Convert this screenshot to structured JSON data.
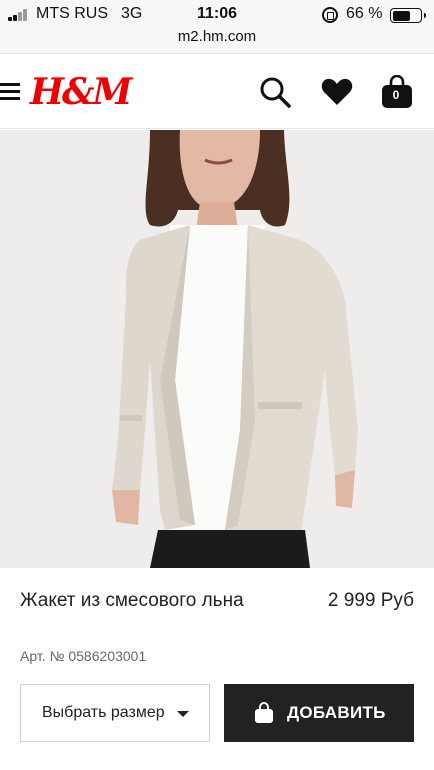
{
  "status_bar": {
    "carrier": "MTS RUS",
    "network": "3G",
    "time": "11:06",
    "battery_percent": "66 %",
    "battery_level": 0.66
  },
  "browser": {
    "url": "m2.hm.com"
  },
  "header": {
    "logo_text": "H&M",
    "cart_count": "0",
    "icons": [
      "menu-icon",
      "search-icon",
      "heart-icon",
      "shopping-bag-icon"
    ],
    "brand_color": "#e00000"
  },
  "product": {
    "name": "Жакет из смесового льна",
    "price": "2 999 Руб",
    "article": "Арт. № 0586203001",
    "size_select_label": "Выбрать размер",
    "add_button_label": "ДОБАВИТЬ"
  }
}
